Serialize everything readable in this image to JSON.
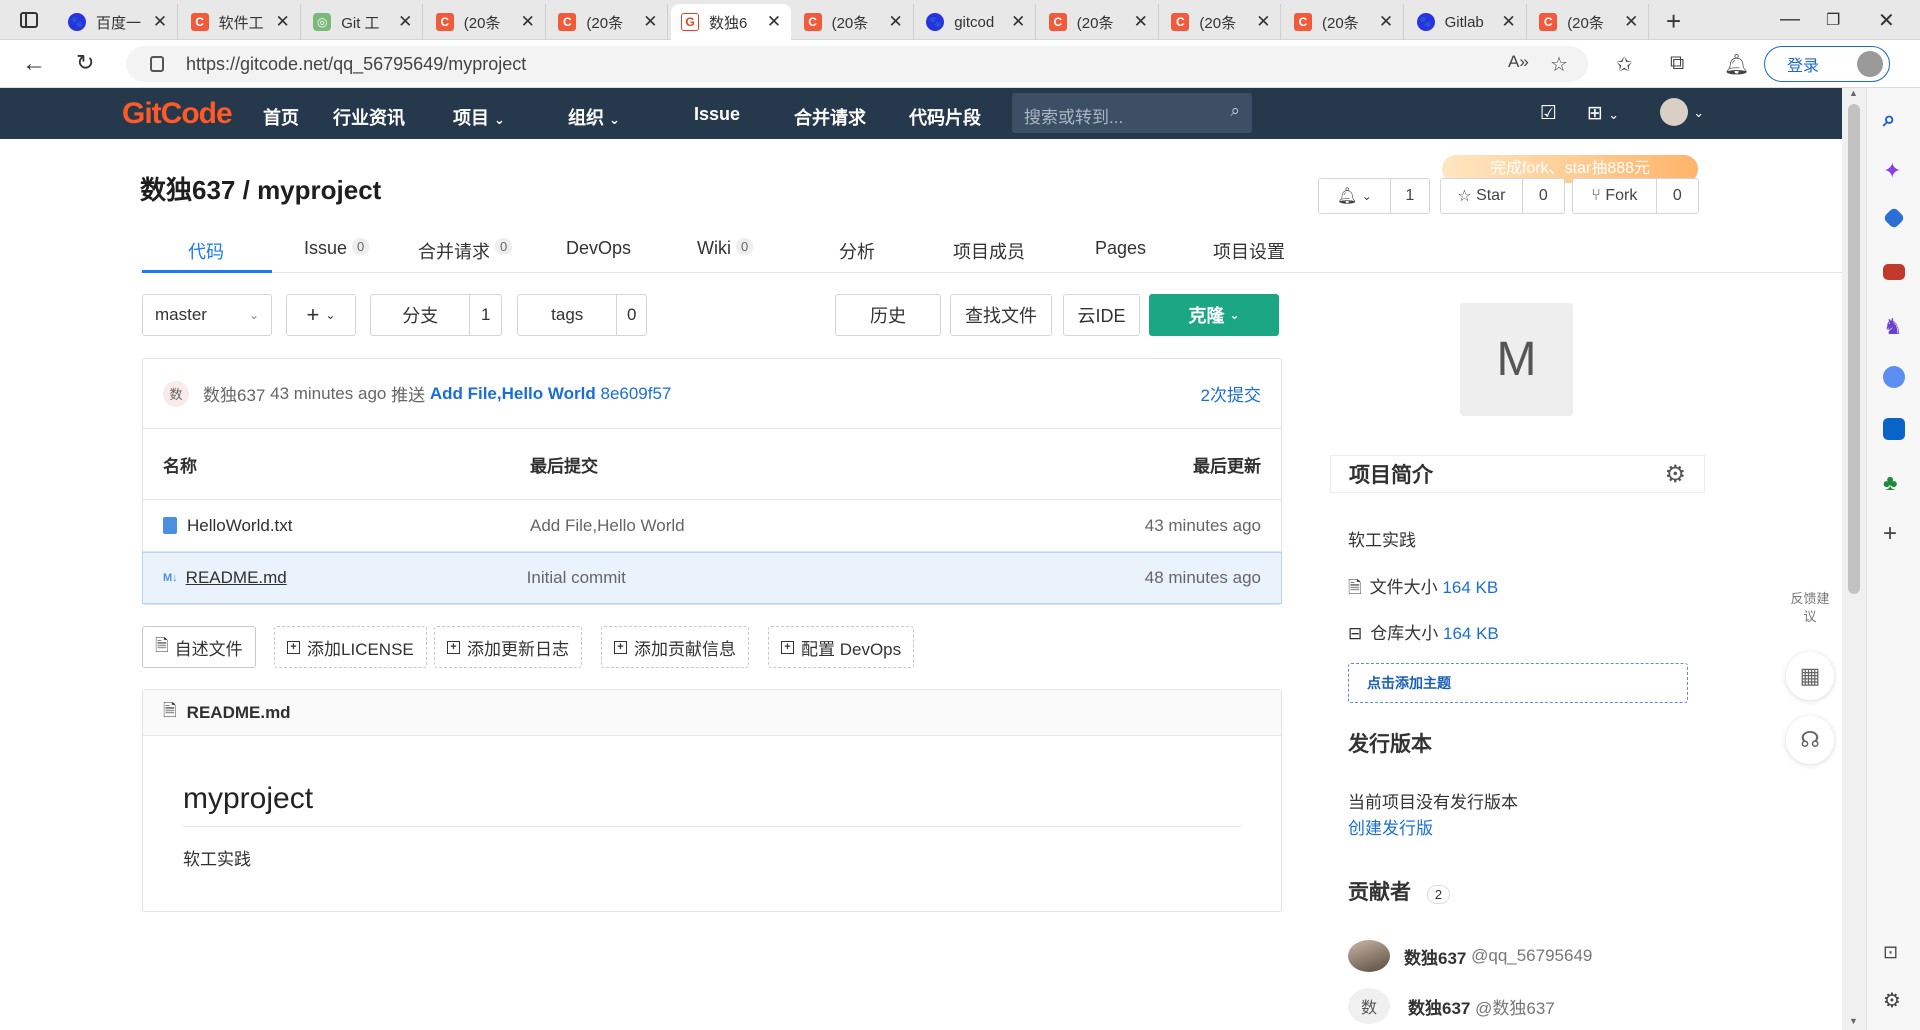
{
  "browser": {
    "tabs": [
      {
        "title": "百度一",
        "icon": "baidu-icon",
        "active": false
      },
      {
        "title": "软件工",
        "icon": "csdn-icon",
        "active": false
      },
      {
        "title": "Git 工",
        "icon": "wechat-icon",
        "active": false
      },
      {
        "title": "(20条",
        "icon": "csdn-icon",
        "active": false
      },
      {
        "title": "(20条",
        "icon": "csdn-icon",
        "active": false
      },
      {
        "title": "数独6",
        "icon": "gitcode-icon",
        "active": true
      },
      {
        "title": "(20条",
        "icon": "csdn-icon",
        "active": false
      },
      {
        "title": "gitcod",
        "icon": "baidu-icon",
        "active": false
      },
      {
        "title": "(20条",
        "icon": "csdn-icon",
        "active": false
      },
      {
        "title": "(20条",
        "icon": "csdn-icon",
        "active": false
      },
      {
        "title": "(20条",
        "icon": "csdn-icon",
        "active": false
      },
      {
        "title": "Gitlab",
        "icon": "baidu-icon",
        "active": false
      },
      {
        "title": "(20条",
        "icon": "csdn-icon",
        "active": false
      }
    ],
    "url": "https://gitcode.net/qq_56795649/myproject",
    "login_label": "登录"
  },
  "header": {
    "logo": "GitCode",
    "nav": [
      "首页",
      "行业资讯",
      "项目",
      "组织",
      "Issue",
      "合并请求",
      "代码片段"
    ],
    "search_placeholder": "搜索或转到..."
  },
  "project": {
    "owner": "数独637",
    "name": "myproject",
    "promo": "完成fork、star抽888元",
    "watch_count": "1",
    "star_label": "Star",
    "star_count": "0",
    "fork_label": "Fork",
    "fork_count": "0"
  },
  "tabs": [
    {
      "label": "代码",
      "badge": ""
    },
    {
      "label": "Issue",
      "badge": "0"
    },
    {
      "label": "合并请求",
      "badge": "0"
    },
    {
      "label": "DevOps",
      "badge": ""
    },
    {
      "label": "Wiki",
      "badge": "0"
    },
    {
      "label": "分析",
      "badge": ""
    },
    {
      "label": "项目成员",
      "badge": ""
    },
    {
      "label": "Pages",
      "badge": ""
    },
    {
      "label": "项目设置",
      "badge": ""
    }
  ],
  "toolbar": {
    "branch": "master",
    "branches_label": "分支",
    "branches_count": "1",
    "tags_label": "tags",
    "tags_count": "0",
    "history": "历史",
    "find_file": "查找文件",
    "cloud_ide": "云IDE",
    "clone": "克隆"
  },
  "last_commit": {
    "avatar": "数",
    "author": "数独637",
    "time": "43 minutes ago",
    "action": "推送",
    "message": "Add File,Hello World",
    "sha": "8e609f57",
    "commit_count": "2次提交"
  },
  "files": {
    "headers": {
      "name": "名称",
      "commit": "最后提交",
      "updated": "最后更新"
    },
    "rows": [
      {
        "name": "HelloWorld.txt",
        "commit": "Add File,Hello World",
        "updated": "43 minutes ago",
        "icon": "file-icon"
      },
      {
        "name": "README.md",
        "commit": "Initial commit",
        "updated": "48 minutes ago",
        "icon": "markdown-icon"
      }
    ]
  },
  "actions": [
    "自述文件",
    "添加LICENSE",
    "添加更新日志",
    "添加贡献信息",
    "配置 DevOps"
  ],
  "readme": {
    "filename": "README.md",
    "heading": "myproject",
    "body": "软工实践"
  },
  "sidebar": {
    "avatar_letter": "M",
    "intro_title": "项目简介",
    "description": "软工实践",
    "file_size_label": "文件大小",
    "file_size": "164 KB",
    "repo_size_label": "仓库大小",
    "repo_size": "164 KB",
    "add_topic": "点击添加主题",
    "releases_title": "发行版本",
    "no_release": "当前项目没有发行版本",
    "create_release": "创建发行版",
    "contributors_title": "贡献者",
    "contributors_count": "2",
    "contributors": [
      {
        "name": "数独637",
        "handle": "@qq_56795649",
        "avatar": ""
      },
      {
        "name": "数独637",
        "handle": "@数独637",
        "avatar": "数"
      }
    ],
    "feedback": "反馈建议"
  },
  "colors": {
    "header_bg": "#26384b",
    "accent": "#1a7cf0",
    "clone": "#1ba784",
    "logo": "#ff5a26"
  }
}
